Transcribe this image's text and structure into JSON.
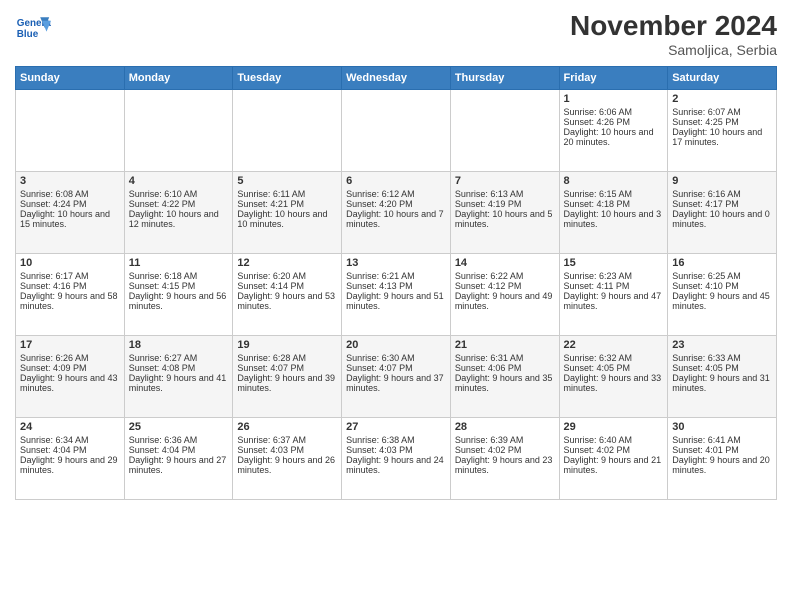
{
  "header": {
    "logo_line1": "General",
    "logo_line2": "Blue",
    "month_title": "November 2024",
    "subtitle": "Samoljica, Serbia"
  },
  "weekdays": [
    "Sunday",
    "Monday",
    "Tuesday",
    "Wednesday",
    "Thursday",
    "Friday",
    "Saturday"
  ],
  "weeks": [
    [
      {
        "day": "",
        "info": ""
      },
      {
        "day": "",
        "info": ""
      },
      {
        "day": "",
        "info": ""
      },
      {
        "day": "",
        "info": ""
      },
      {
        "day": "",
        "info": ""
      },
      {
        "day": "1",
        "info": "Sunrise: 6:06 AM\nSunset: 4:26 PM\nDaylight: 10 hours and 20 minutes."
      },
      {
        "day": "2",
        "info": "Sunrise: 6:07 AM\nSunset: 4:25 PM\nDaylight: 10 hours and 17 minutes."
      }
    ],
    [
      {
        "day": "3",
        "info": "Sunrise: 6:08 AM\nSunset: 4:24 PM\nDaylight: 10 hours and 15 minutes."
      },
      {
        "day": "4",
        "info": "Sunrise: 6:10 AM\nSunset: 4:22 PM\nDaylight: 10 hours and 12 minutes."
      },
      {
        "day": "5",
        "info": "Sunrise: 6:11 AM\nSunset: 4:21 PM\nDaylight: 10 hours and 10 minutes."
      },
      {
        "day": "6",
        "info": "Sunrise: 6:12 AM\nSunset: 4:20 PM\nDaylight: 10 hours and 7 minutes."
      },
      {
        "day": "7",
        "info": "Sunrise: 6:13 AM\nSunset: 4:19 PM\nDaylight: 10 hours and 5 minutes."
      },
      {
        "day": "8",
        "info": "Sunrise: 6:15 AM\nSunset: 4:18 PM\nDaylight: 10 hours and 3 minutes."
      },
      {
        "day": "9",
        "info": "Sunrise: 6:16 AM\nSunset: 4:17 PM\nDaylight: 10 hours and 0 minutes."
      }
    ],
    [
      {
        "day": "10",
        "info": "Sunrise: 6:17 AM\nSunset: 4:16 PM\nDaylight: 9 hours and 58 minutes."
      },
      {
        "day": "11",
        "info": "Sunrise: 6:18 AM\nSunset: 4:15 PM\nDaylight: 9 hours and 56 minutes."
      },
      {
        "day": "12",
        "info": "Sunrise: 6:20 AM\nSunset: 4:14 PM\nDaylight: 9 hours and 53 minutes."
      },
      {
        "day": "13",
        "info": "Sunrise: 6:21 AM\nSunset: 4:13 PM\nDaylight: 9 hours and 51 minutes."
      },
      {
        "day": "14",
        "info": "Sunrise: 6:22 AM\nSunset: 4:12 PM\nDaylight: 9 hours and 49 minutes."
      },
      {
        "day": "15",
        "info": "Sunrise: 6:23 AM\nSunset: 4:11 PM\nDaylight: 9 hours and 47 minutes."
      },
      {
        "day": "16",
        "info": "Sunrise: 6:25 AM\nSunset: 4:10 PM\nDaylight: 9 hours and 45 minutes."
      }
    ],
    [
      {
        "day": "17",
        "info": "Sunrise: 6:26 AM\nSunset: 4:09 PM\nDaylight: 9 hours and 43 minutes."
      },
      {
        "day": "18",
        "info": "Sunrise: 6:27 AM\nSunset: 4:08 PM\nDaylight: 9 hours and 41 minutes."
      },
      {
        "day": "19",
        "info": "Sunrise: 6:28 AM\nSunset: 4:07 PM\nDaylight: 9 hours and 39 minutes."
      },
      {
        "day": "20",
        "info": "Sunrise: 6:30 AM\nSunset: 4:07 PM\nDaylight: 9 hours and 37 minutes."
      },
      {
        "day": "21",
        "info": "Sunrise: 6:31 AM\nSunset: 4:06 PM\nDaylight: 9 hours and 35 minutes."
      },
      {
        "day": "22",
        "info": "Sunrise: 6:32 AM\nSunset: 4:05 PM\nDaylight: 9 hours and 33 minutes."
      },
      {
        "day": "23",
        "info": "Sunrise: 6:33 AM\nSunset: 4:05 PM\nDaylight: 9 hours and 31 minutes."
      }
    ],
    [
      {
        "day": "24",
        "info": "Sunrise: 6:34 AM\nSunset: 4:04 PM\nDaylight: 9 hours and 29 minutes."
      },
      {
        "day": "25",
        "info": "Sunrise: 6:36 AM\nSunset: 4:04 PM\nDaylight: 9 hours and 27 minutes."
      },
      {
        "day": "26",
        "info": "Sunrise: 6:37 AM\nSunset: 4:03 PM\nDaylight: 9 hours and 26 minutes."
      },
      {
        "day": "27",
        "info": "Sunrise: 6:38 AM\nSunset: 4:03 PM\nDaylight: 9 hours and 24 minutes."
      },
      {
        "day": "28",
        "info": "Sunrise: 6:39 AM\nSunset: 4:02 PM\nDaylight: 9 hours and 23 minutes."
      },
      {
        "day": "29",
        "info": "Sunrise: 6:40 AM\nSunset: 4:02 PM\nDaylight: 9 hours and 21 minutes."
      },
      {
        "day": "30",
        "info": "Sunrise: 6:41 AM\nSunset: 4:01 PM\nDaylight: 9 hours and 20 minutes."
      }
    ]
  ]
}
